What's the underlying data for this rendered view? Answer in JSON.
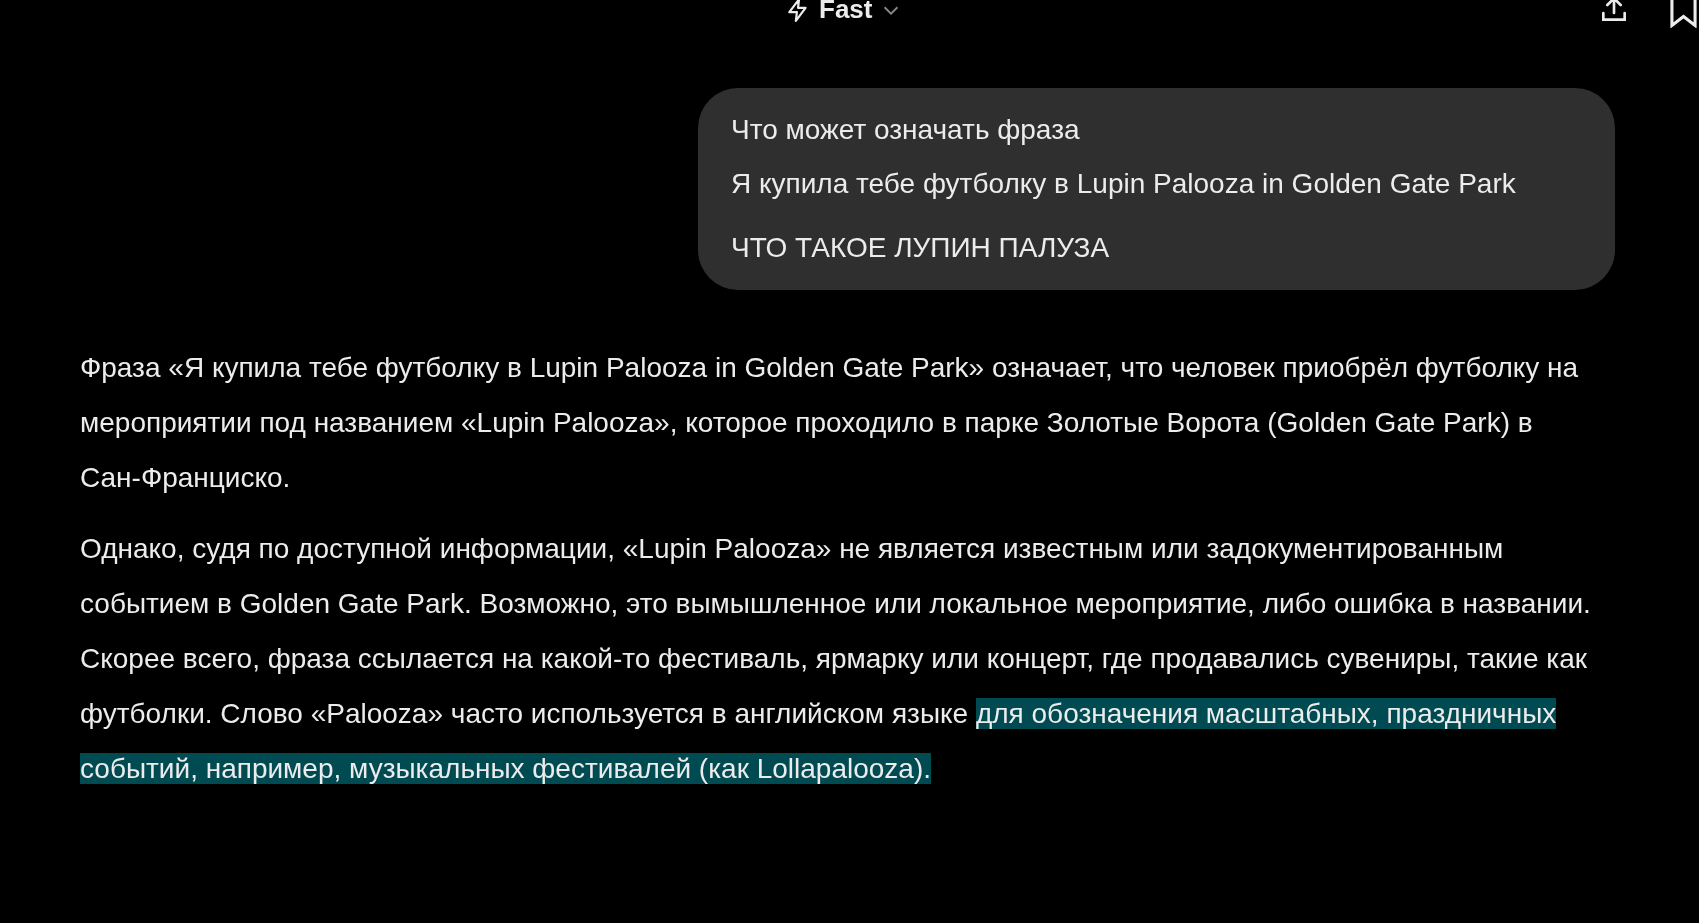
{
  "header": {
    "model": "Fast"
  },
  "user_message": {
    "lines": [
      "Что может означать фраза",
      "Я купила тебе футболку в Lupin Palooza in Golden Gate Park",
      "ЧТО ТАКОЕ ЛУПИН ПАЛУЗА"
    ]
  },
  "answer": {
    "paragraphs": [
      {
        "segments": [
          {
            "text": "Фраза «Я купила тебе футболку в Lupin Palooza in Golden Gate Park» означает, что человек приобрёл футболку на мероприятии под названием «Lupin Palooza», которое проходило в парке Золотые Ворота (Golden Gate Park) в Сан-Франциско.",
            "selected": false
          }
        ]
      },
      {
        "segments": [
          {
            "text": "Однако, судя по доступной информации, «Lupin Palooza» не является известным или задокументированным событием в Golden Gate Park. Возможно, это вымышленное или локальное мероприятие, либо ошибка в названии. Скорее всего, фраза ссылается на какой-то фестиваль, ярмарку или концерт, где продавались сувениры, такие как футболки. Слово «Palooza» часто используется в английском языке ",
            "selected": false
          },
          {
            "text": "для обозначения масштабных, праздничных событий, например, музыкальных фестивалей (как Lollapalooza).",
            "selected": true
          }
        ]
      }
    ]
  }
}
